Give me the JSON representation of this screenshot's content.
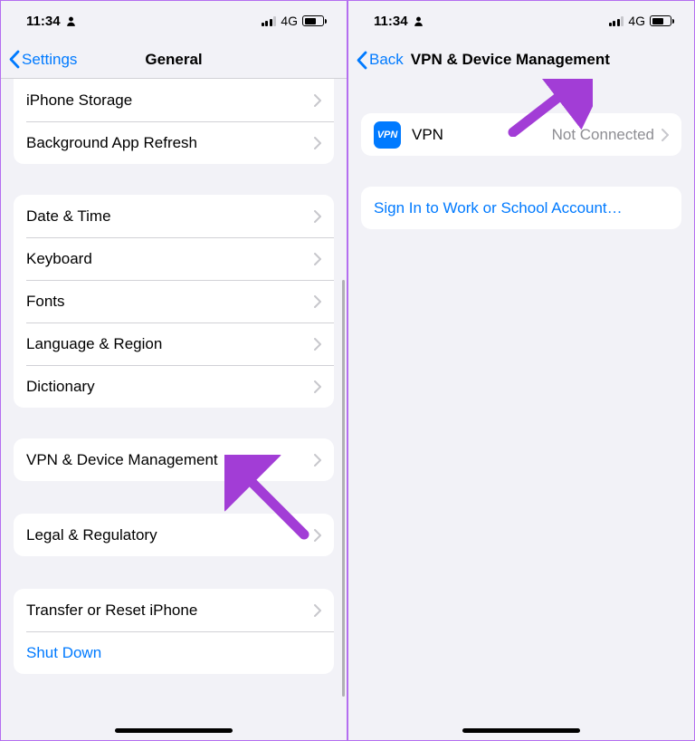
{
  "status": {
    "time": "11:34",
    "network": "4G"
  },
  "left": {
    "back_label": "Settings",
    "title": "General",
    "group1": [
      {
        "label": "iPhone Storage"
      },
      {
        "label": "Background App Refresh"
      }
    ],
    "group2": [
      {
        "label": "Date & Time"
      },
      {
        "label": "Keyboard"
      },
      {
        "label": "Fonts"
      },
      {
        "label": "Language & Region"
      },
      {
        "label": "Dictionary"
      }
    ],
    "group3": [
      {
        "label": "VPN & Device Management"
      }
    ],
    "group4": [
      {
        "label": "Legal & Regulatory"
      }
    ],
    "group5": [
      {
        "label": "Transfer or Reset iPhone",
        "chevron": true
      },
      {
        "label": "Shut Down",
        "link": true
      }
    ]
  },
  "right": {
    "back_label": "Back",
    "title": "VPN & Device Management",
    "vpn_icon_text": "VPN",
    "vpn_label": "VPN",
    "vpn_status": "Not Connected",
    "signin_label": "Sign In to Work or School Account…"
  }
}
